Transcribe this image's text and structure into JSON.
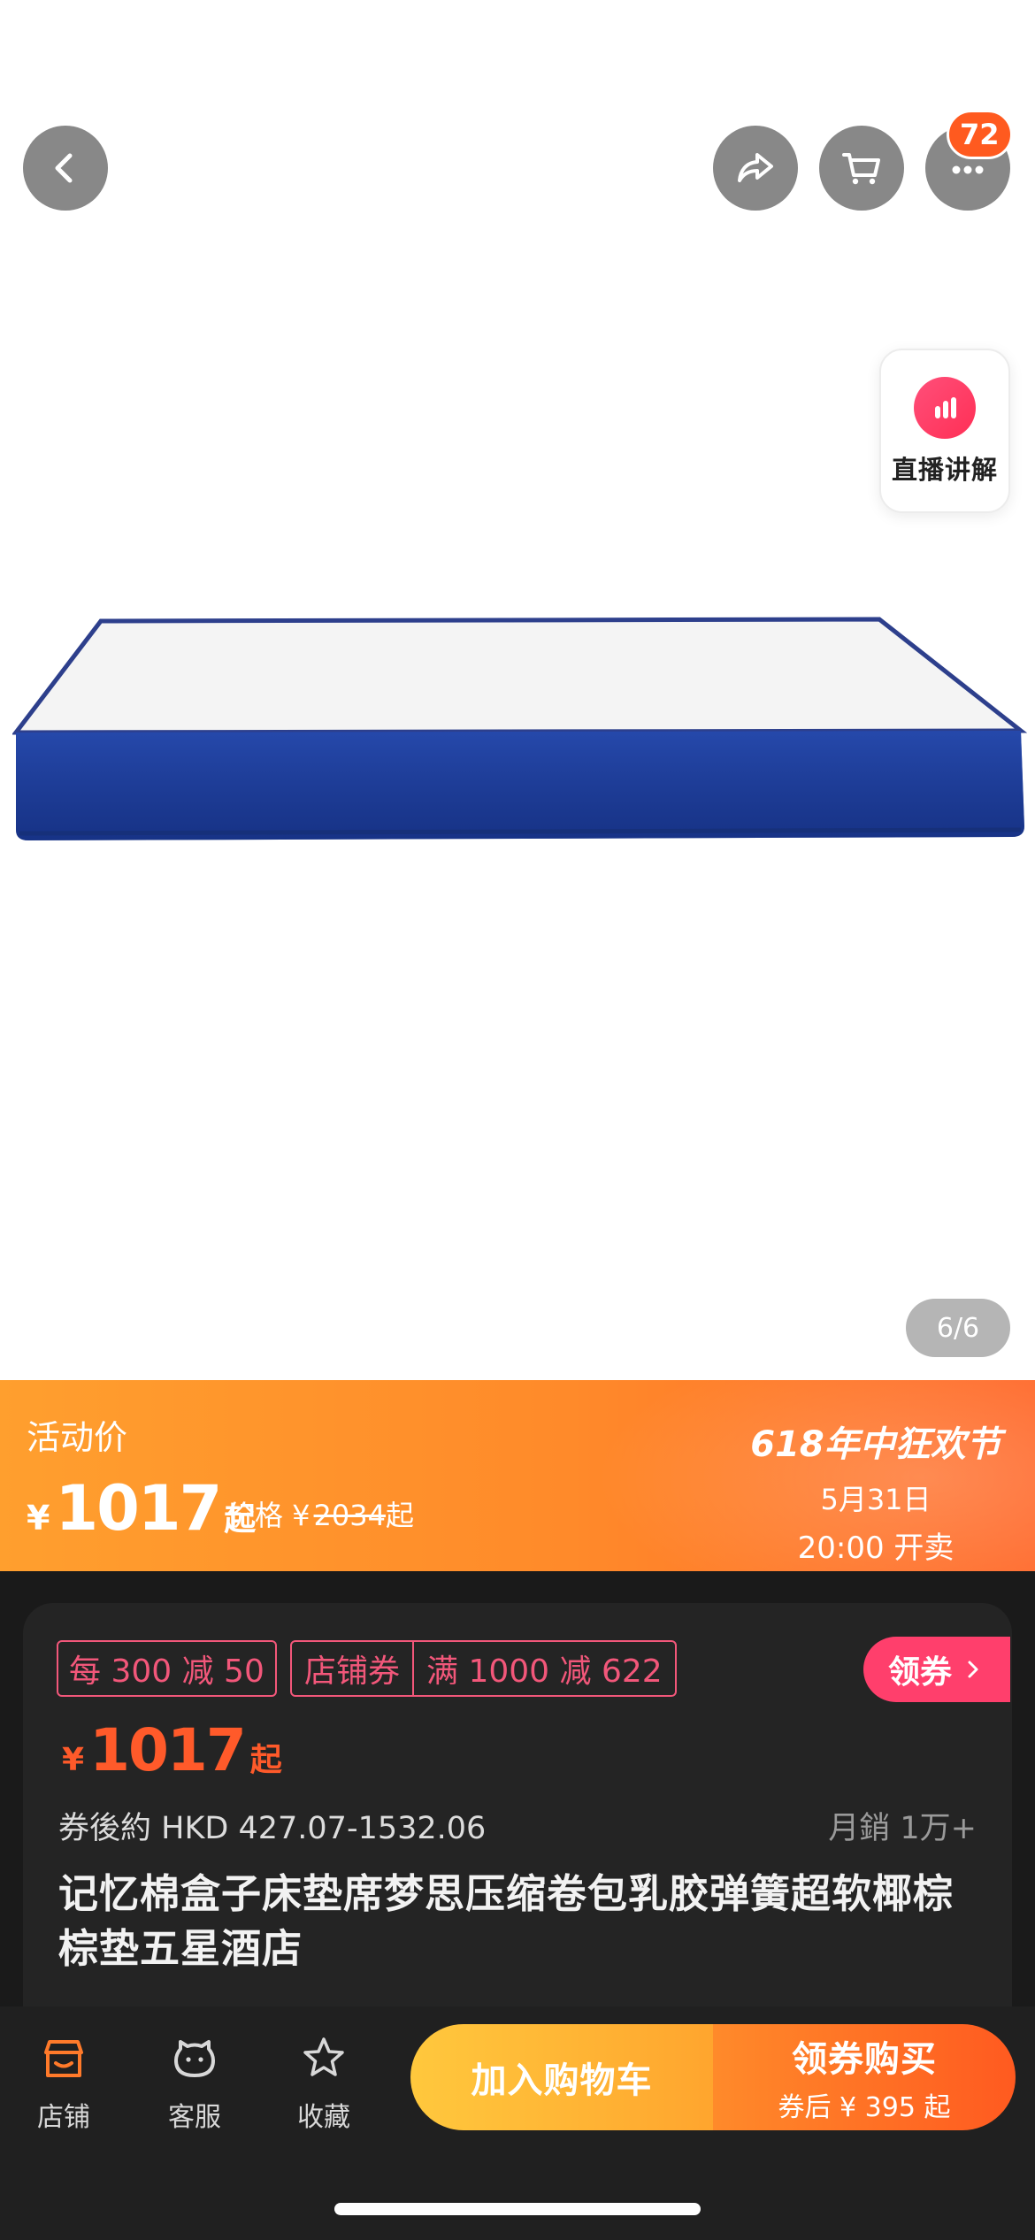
{
  "header": {
    "cart_badge_count": "72",
    "icons": [
      "back-arrow-icon",
      "share-icon",
      "cart-icon",
      "more-icon"
    ]
  },
  "live_entry": {
    "label": "直播讲解",
    "icon": "live-bars-icon"
  },
  "gallery": {
    "counter": "6/6"
  },
  "promo": {
    "label": "活动价",
    "currency": "¥",
    "price": "1017",
    "suffix": "起",
    "orig_prefix": "价格 ¥",
    "orig_price": "2034",
    "orig_suffix": "起",
    "event_name": "618年中狂欢节",
    "event_date": "5月31日",
    "event_time": "20:00 开卖",
    "colors": {
      "start": "#ff9f2e",
      "end": "#ff6a2c"
    }
  },
  "coupons": {
    "tag1": "每 300 减 50",
    "tag2_a": "店铺券",
    "tag2_b": "满 1000 减 622",
    "claim_label": "领券",
    "accent_color": "#f2577a"
  },
  "product": {
    "currency": "¥",
    "price": "1017",
    "suffix": "起",
    "after_coupon": "券後約 HKD 427.07-1532.06",
    "monthly_sales": "月銷 1万+",
    "title": "记忆棉盒子床垫席梦思压缩卷包乳胶弹簧超软椰棕棕垫五星酒店"
  },
  "bottom_bar": {
    "shop": "店铺",
    "service": "客服",
    "favorite": "收藏",
    "add_to_cart": "加入购物车",
    "buy_main": "领券购买",
    "buy_sub": "券后 ¥ 395 起"
  }
}
